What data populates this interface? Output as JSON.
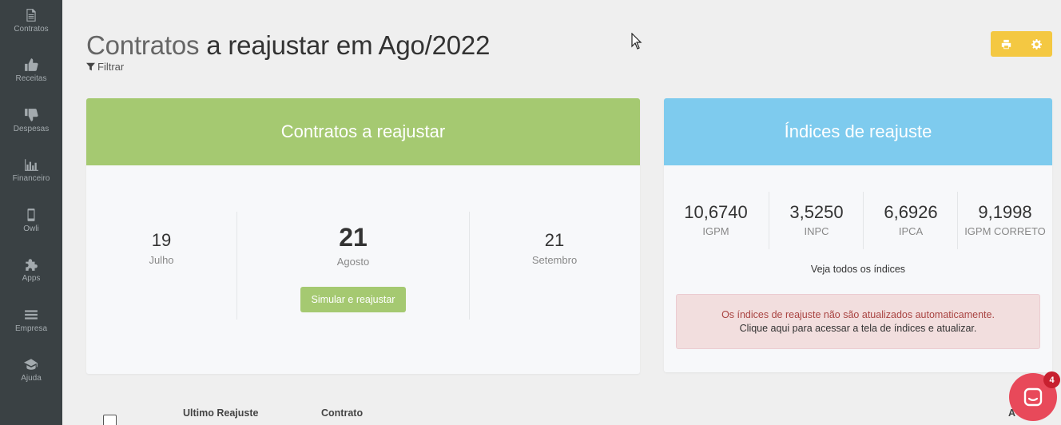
{
  "sidebar": {
    "items": [
      {
        "label": "Contratos",
        "icon": "document-icon"
      },
      {
        "label": "Receitas",
        "icon": "thumbs-up-icon"
      },
      {
        "label": "Despesas",
        "icon": "thumbs-down-icon"
      },
      {
        "label": "Financeiro",
        "icon": "bar-chart-icon"
      },
      {
        "label": "Owli",
        "icon": "mobile-icon"
      },
      {
        "label": "Apps",
        "icon": "puzzle-icon"
      },
      {
        "label": "Empresa",
        "icon": "menu-bars-icon"
      },
      {
        "label": "Ajuda",
        "icon": "graduation-cap-icon"
      }
    ]
  },
  "header": {
    "title_prefix": "Contratos",
    "title_rest": " a reajustar em Ago/2022",
    "filter_label": "Filtrar"
  },
  "toolbar": {
    "print_icon": "print-icon",
    "settings_icon": "gear-icon",
    "accent": "#f4c842"
  },
  "contracts_card": {
    "title": "Contratos a reajustar",
    "accent": "#a5c971",
    "months": [
      {
        "count": "19",
        "name": "Julho"
      },
      {
        "count": "21",
        "name": "Agosto"
      },
      {
        "count": "21",
        "name": "Setembro"
      }
    ],
    "button_label": "Simular e reajustar"
  },
  "indices_card": {
    "title": "Índices de reajuste",
    "accent": "#7ecbee",
    "indices": [
      {
        "value": "10,6740",
        "name": "IGPM"
      },
      {
        "value": "3,5250",
        "name": "INPC"
      },
      {
        "value": "6,6926",
        "name": "IPCA"
      },
      {
        "value": "9,1998",
        "name": "IGPM CORRETO"
      }
    ],
    "see_all": "Veja todos os índices",
    "alert_line1": "Os índices de reajuste não são atualizados automaticamente.",
    "alert_line2": "Clique aqui para acessar a tela de índices e atualizar."
  },
  "table": {
    "columns": [
      "Ultimo Reajuste",
      "Contrato",
      "A"
    ]
  },
  "chat": {
    "badge_count": "4"
  }
}
